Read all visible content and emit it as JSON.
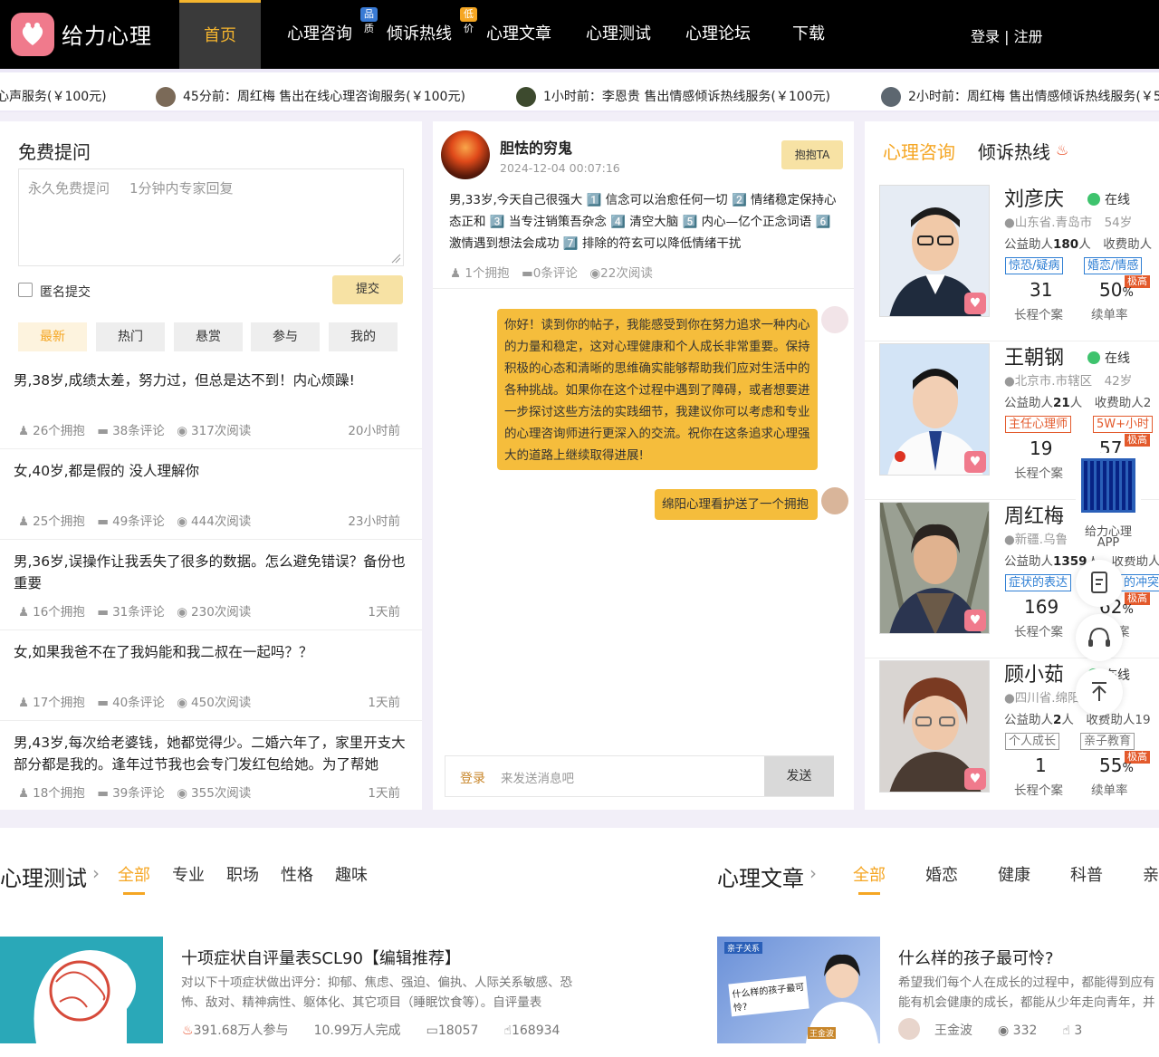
{
  "header": {
    "brand": "给力心理",
    "nav": [
      {
        "label": "首页",
        "active": true
      },
      {
        "label": "心理咨询",
        "badge": "品质",
        "badge_color": "#3a7bd5"
      },
      {
        "label": "倾诉热线",
        "badge": "低价",
        "badge_color": "#f5a623"
      },
      {
        "label": "心理文章"
      },
      {
        "label": "心理测试"
      },
      {
        "label": "心理论坛"
      },
      {
        "label": "下载"
      }
    ],
    "login": "登录 | 注册"
  },
  "ticker": [
    "心声服务(￥100元)",
    "45分前：周红梅 售出在线心理咨询服务(￥100元)",
    "1小时前：李恩贵 售出情感倾诉热线服务(￥100元)",
    "2小时前：周红梅 售出情感倾诉热线服务(￥5"
  ],
  "ask": {
    "title": "免费提问",
    "placeholder_a": "永久免费提问",
    "placeholder_b": "1分钟内专家回复",
    "anon": "匿名提交",
    "submit": "提交",
    "tabs": [
      "最新",
      "热门",
      "悬赏",
      "参与",
      "我的"
    ]
  },
  "posts": [
    {
      "title": "男,38岁,成绩太差，努力过，但总是达不到！内心烦躁!",
      "hugs": "26个拥抱",
      "comments": "38条评论",
      "reads": "317次阅读",
      "time": "20小时前"
    },
    {
      "title": "女,40岁,都是假的 没人理解你",
      "hugs": "25个拥抱",
      "comments": "49条评论",
      "reads": "444次阅读",
      "time": "23小时前"
    },
    {
      "title": "男,36岁,误操作让我丢失了很多的数据。怎么避免错误？备份也重要",
      "hugs": "16个拥抱",
      "comments": "31条评论",
      "reads": "230次阅读",
      "time": "1天前"
    },
    {
      "title": "女,如果我爸不在了我妈能和我二叔在一起吗？？",
      "hugs": "17个拥抱",
      "comments": "40条评论",
      "reads": "450次阅读",
      "time": "1天前"
    },
    {
      "title": "男,43岁,每次给老婆钱，她都觉得少。二婚六年了，家里开支大部分都是我的。逢年过节我也会专门发红包给她。为了帮她",
      "hugs": "18个拥抱",
      "comments": "39条评论",
      "reads": "355次阅读",
      "time": "1天前"
    }
  ],
  "feature": {
    "author": "胆怯的穷鬼",
    "date": "2024-12-04 00:07:16",
    "hug_btn": "抱抱TA",
    "text": "男,33岁,今天自己很强大 1️⃣ 信念可以治愈任何一切 2️⃣ 情绪稳定保持心态正和 3️⃣ 当专注销策吾杂念 4️⃣ 清空大脑 5️⃣ 内心—亿个正念词语 6️⃣ 激情遇到想法会成功 7️⃣ 排除的符玄可以降低情绪干扰",
    "hugs": "1个拥抱",
    "comments": "0条评论",
    "reads": "22次阅读",
    "reply": "你好！读到你的帖子，我能感受到你在努力追求一种内心的力量和稳定，这对心理健康和个人成长非常重要。保持积极的心态和清晰的思维确实能够帮助我们应对生活中的各种挑战。如果你在这个过程中遇到了障碍，或者想要进一步探讨这些方法的实践细节，我建议你可以考虑和专业的心理咨询师进行更深入的交流。祝你在这条追求心理强大的道路上继续取得进展!",
    "hug_msg": "绵阳心理看护送了一个拥抱",
    "login": "登录",
    "placeholder": "来发送消息吧",
    "send": "发送"
  },
  "right": {
    "tabs": [
      "心理咨询",
      "倾诉热线"
    ],
    "doctors": [
      {
        "name": "刘彦庆",
        "online": "在线",
        "loc": "山东省.青岛市",
        "age": "54岁",
        "help_a": "公益助人",
        "help_a_n": "180",
        "unit": "人",
        "help_b": "收费助人",
        "tags": [
          "惊恐/疑病",
          "婚恋/情感"
        ],
        "n1": "31",
        "n1_l": "长程个案",
        "n2": "50",
        "n2_u": "%",
        "n2_l": "续单率",
        "hot": "极高"
      },
      {
        "name": "王朝钢",
        "online": "在线",
        "loc": "北京市.市辖区",
        "age": "42岁",
        "help_a": "公益助人",
        "help_a_n": "21",
        "unit": "人",
        "help_b": "收费助人2",
        "tags": [
          "主任心理师",
          "5W+小时"
        ],
        "n1": "19",
        "n1_l": "长程个案",
        "n2": "57",
        "n2_u": "",
        "n2_l": "",
        "hot": "极高"
      },
      {
        "name": "周红梅",
        "online": "",
        "loc": "新疆.乌鲁",
        "age": "",
        "help_a": "公益助人",
        "help_a_n": "1359",
        "unit": "人",
        "help_b": "收费助人",
        "tags": [
          "症状的表达",
          "的冲突"
        ],
        "n1": "169",
        "n1_l": "长程个案",
        "n2": "62",
        "n2_u": "%",
        "n2_l": "案",
        "hot": "极高"
      },
      {
        "name": "顾小茹",
        "online": "在线",
        "loc": "四川省.绵阳",
        "age": "6岁",
        "help_a": "公益助人",
        "help_a_n": "2",
        "unit": "人",
        "help_b": "收费助人19",
        "tags": [
          "个人成长",
          "亲子教育"
        ],
        "n1": "1",
        "n1_l": "长程个案",
        "n2": "55",
        "n2_u": "%",
        "n2_l": "续单率",
        "hot": "极高"
      }
    ],
    "app_label": "给力心理",
    "app_label2": "APP"
  },
  "tests": {
    "title": "心理测试",
    "tabs": [
      "全部",
      "专业",
      "职场",
      "性格",
      "趣味"
    ],
    "item": {
      "title": "十项症状自评量表SCL90【编辑推荐】",
      "desc": "对以下十项症状做出评分：抑郁、焦虑、强迫、偏执、人际关系敏感、恐怖、敌对、精神病性、躯体化、其它项目（睡眠饮食等）。自评量表",
      "joined": "391.68万人参与",
      "done": "10.99万人完成",
      "comments": "18057",
      "likes": "168934"
    }
  },
  "articles": {
    "title": "心理文章",
    "tabs": [
      "全部",
      "婚恋",
      "健康",
      "科普",
      "亲"
    ],
    "item": {
      "title": "什么样的孩子最可怜?",
      "desc": "希望我们每个人在成长的过程中，都能得到应有能有机会健康的成长，都能从少年走向青年，并",
      "author": "王金波",
      "views": "332",
      "likes": "3",
      "thumb_tag": "亲子关系",
      "thumb_text": "什么样的孩子最可怜?",
      "thumb_name": "王金波"
    }
  }
}
